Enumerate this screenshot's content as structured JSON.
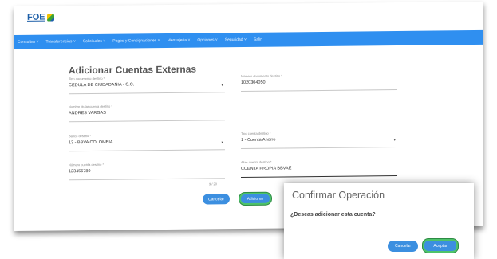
{
  "app": {
    "logo_text": "FOE"
  },
  "nav": {
    "items": [
      "Consultas ˅",
      "Transferencias ˅",
      "Solicitudes ˅",
      "Pagos y Consignaciones ˅",
      "Mensajeria ˅",
      "Opciones ˅",
      "Seguridad ˅",
      "Salir"
    ]
  },
  "form": {
    "title": "Adicionar Cuentas Externas",
    "doc_type_label": "Tipo documento destino *",
    "doc_type_value": "CEDULA DE CIUDADANIA - C.C.",
    "doc_number_label": "Número documento destino *",
    "doc_number_value": "1020304050",
    "holder_name_label": "Nombre titular cuenta destino *",
    "holder_name_value": "ANDRES VARGAS",
    "bank_label": "Banco destino *",
    "bank_value": "13 - BBVA COLOMBIA",
    "account_type_label": "Tipo cuenta destino *",
    "account_type_value": "1 - Cuenta Ahorro",
    "account_number_label": "Número cuenta destino *",
    "account_number_value": "123456789",
    "account_number_counter": "9 / 20",
    "alias_label": "Alias cuenta destino *",
    "alias_value": "CUENTA PROPIA BBVAE",
    "cancel_label": "Cancelar",
    "submit_label": "Adicionar"
  },
  "dialog": {
    "title": "Confirmar Operación",
    "message": "¿Deseas adicionar esta cuenta?",
    "cancel_label": "Cancelar",
    "accept_label": "Aceptar"
  },
  "colors": {
    "nav": "#2f8ff0",
    "button": "#3c8fe0",
    "highlight": "#4ec36a"
  }
}
